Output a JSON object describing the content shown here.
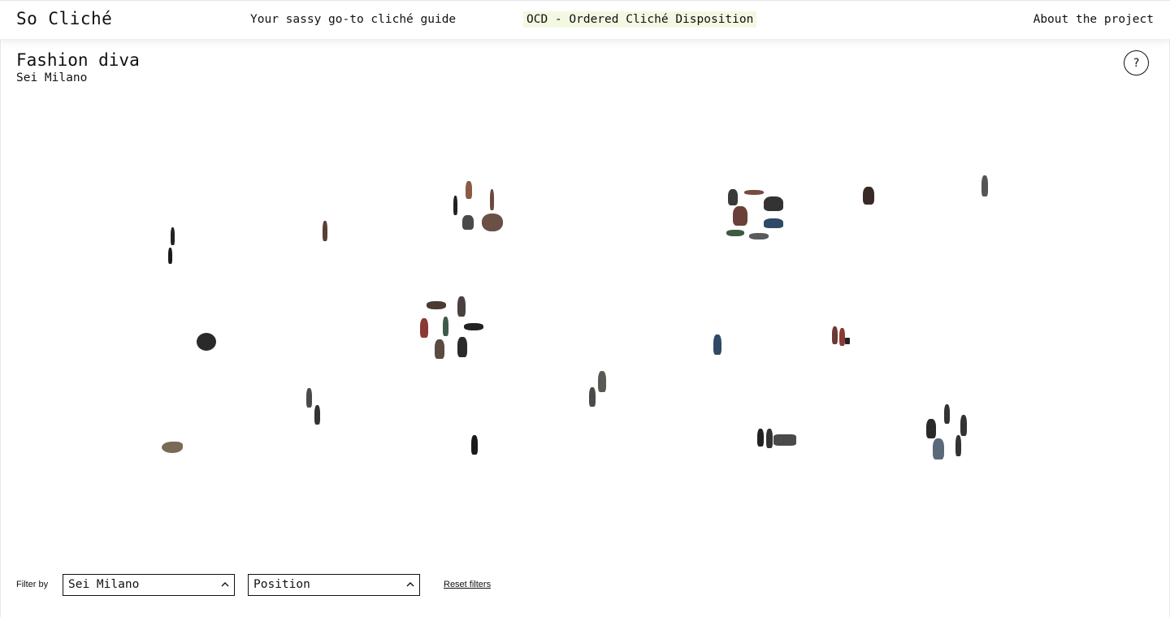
{
  "header": {
    "brand": "So Cliché",
    "tagline": "Your sassy go-to cliché guide",
    "active_view": "OCD - Ordered Cliché Disposition",
    "about_link": "About the project",
    "active_highlight_color": "#f3f8e2"
  },
  "page": {
    "title": "Fashion diva",
    "subtitle": "Sei Milano",
    "help_label": "?"
  },
  "filters": {
    "label": "Filter by",
    "primary_select": {
      "value": "Sei Milano",
      "icon": "chevron-up-icon"
    },
    "secondary_select": {
      "value": "Position",
      "icon": "chevron-up-icon"
    },
    "reset_label": "Reset filters"
  },
  "colors": {
    "figure_dark": "#222222",
    "figure_brown": "#5a3d33",
    "figure_red": "#8a3a34",
    "figure_blue": "#2f4a66",
    "figure_khaki": "#7a6a55"
  }
}
